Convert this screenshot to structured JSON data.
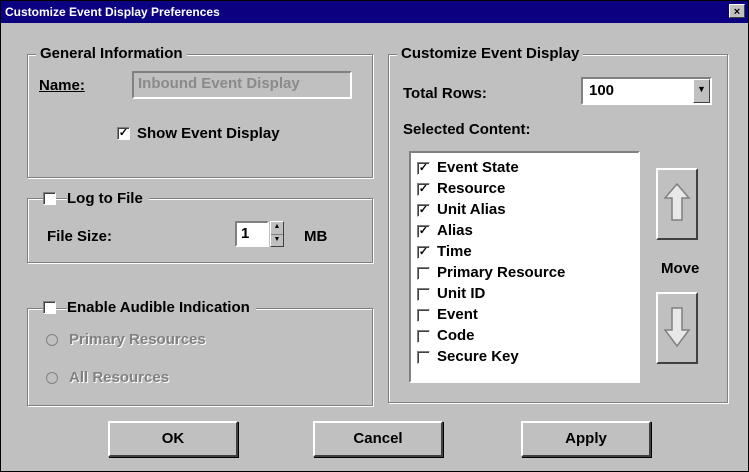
{
  "window": {
    "title": "Customize Event Display Preferences",
    "close_label": "×"
  },
  "general": {
    "legend": "General Information",
    "name_label": "Name:",
    "name_value": "Inbound Event Display",
    "show_event_display_label": "Show Event Display",
    "show_event_display_checked": true
  },
  "log": {
    "label": "Log to File",
    "checked": false,
    "file_size_label": "File Size:",
    "file_size_value": "1",
    "file_size_unit": "MB"
  },
  "audible": {
    "label": "Enable Audible Indication",
    "checked": false,
    "options": [
      "Primary Resources",
      "All Resources"
    ]
  },
  "customize": {
    "legend": "Customize Event Display",
    "total_rows_label": "Total Rows:",
    "total_rows_value": "100",
    "selected_content_label": "Selected Content:",
    "items": [
      {
        "label": "Event State",
        "checked": true
      },
      {
        "label": "Resource",
        "checked": true
      },
      {
        "label": "Unit Alias",
        "checked": true
      },
      {
        "label": "Alias",
        "checked": true
      },
      {
        "label": "Time",
        "checked": true
      },
      {
        "label": "Primary Resource",
        "checked": false
      },
      {
        "label": "Unit ID",
        "checked": false
      },
      {
        "label": "Event",
        "checked": false
      },
      {
        "label": "Code",
        "checked": false
      },
      {
        "label": "Secure Key",
        "checked": false
      }
    ],
    "move_label": "Move"
  },
  "buttons": {
    "ok": "OK",
    "cancel": "Cancel",
    "apply": "Apply"
  },
  "colors": {
    "titlebar": "#0a0080",
    "face": "#c0c0c0"
  },
  "icons": [
    "close-icon",
    "checkbox-icon",
    "radio-icon",
    "dropdown-arrow-icon",
    "spin-up-icon",
    "spin-down-icon",
    "arrow-up-icon",
    "arrow-down-icon"
  ]
}
